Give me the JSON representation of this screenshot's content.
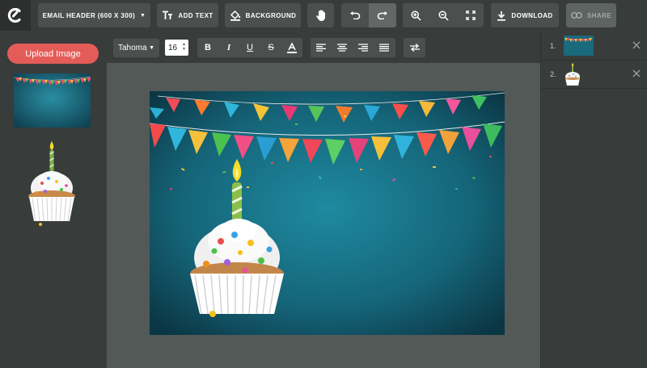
{
  "toolbar": {
    "template_label": "EMAIL HEADER (600 X 300)",
    "add_text_label": "ADD TEXT",
    "background_label": "BACKGROUND",
    "download_label": "DOWNLOAD",
    "share_label": "SHARE"
  },
  "left_panel": {
    "upload_label": "Upload Image"
  },
  "text_toolbar": {
    "font": "Tahoma",
    "font_size": "16"
  },
  "layers": [
    {
      "number": "1.",
      "content": "banner background"
    },
    {
      "number": "2.",
      "content": "cupcake"
    }
  ],
  "colors": {
    "accent": "#e45c58",
    "panel": "#383c3b",
    "workspace": "#525957",
    "canvas_background": "#1b5f70"
  }
}
